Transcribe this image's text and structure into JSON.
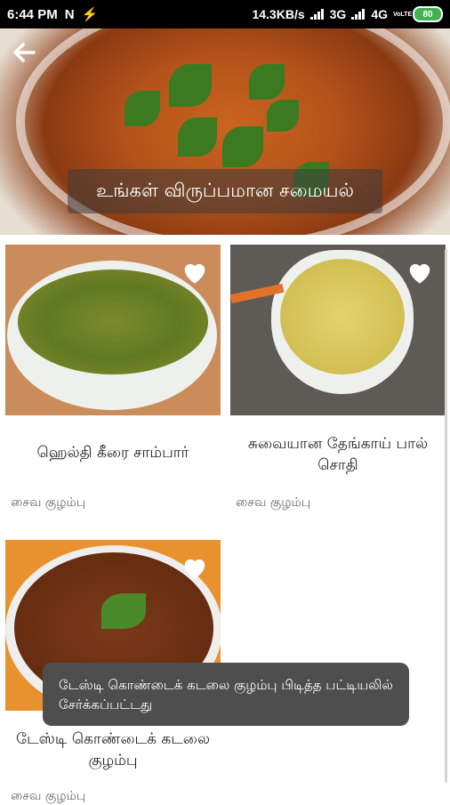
{
  "status_bar": {
    "time": "6:44 PM",
    "left_icons": [
      "N",
      "⚡"
    ],
    "speed": "14.3KB/s",
    "net1": "3G",
    "net2": "4G",
    "volte": "VoLTE",
    "battery": "80"
  },
  "header": {
    "banner_text": "உங்கள் விருப்பமான சமையல்",
    "back_icon": "arrow-left-icon"
  },
  "recipes": [
    {
      "title": "ஹெல்தி   கீரை சாம்பார்",
      "category": "சைவ குழம்பு"
    },
    {
      "title": "சுவையான தேங்காய் பால் சொதி",
      "category": "சைவ குழம்பு"
    },
    {
      "title": "டேஸ்டி கொண்டைக் கடலை குழம்பு",
      "category": "சைவ குழம்பு"
    }
  ],
  "toast": {
    "message": "டேஸ்டி கொண்டைக் கடலை குழம்பு பிடித்த பட்டியலில் சேர்க்கப்பட்டது"
  },
  "colors": {
    "heart": "#ffffff",
    "toast_bg": "#4e4e4e"
  }
}
